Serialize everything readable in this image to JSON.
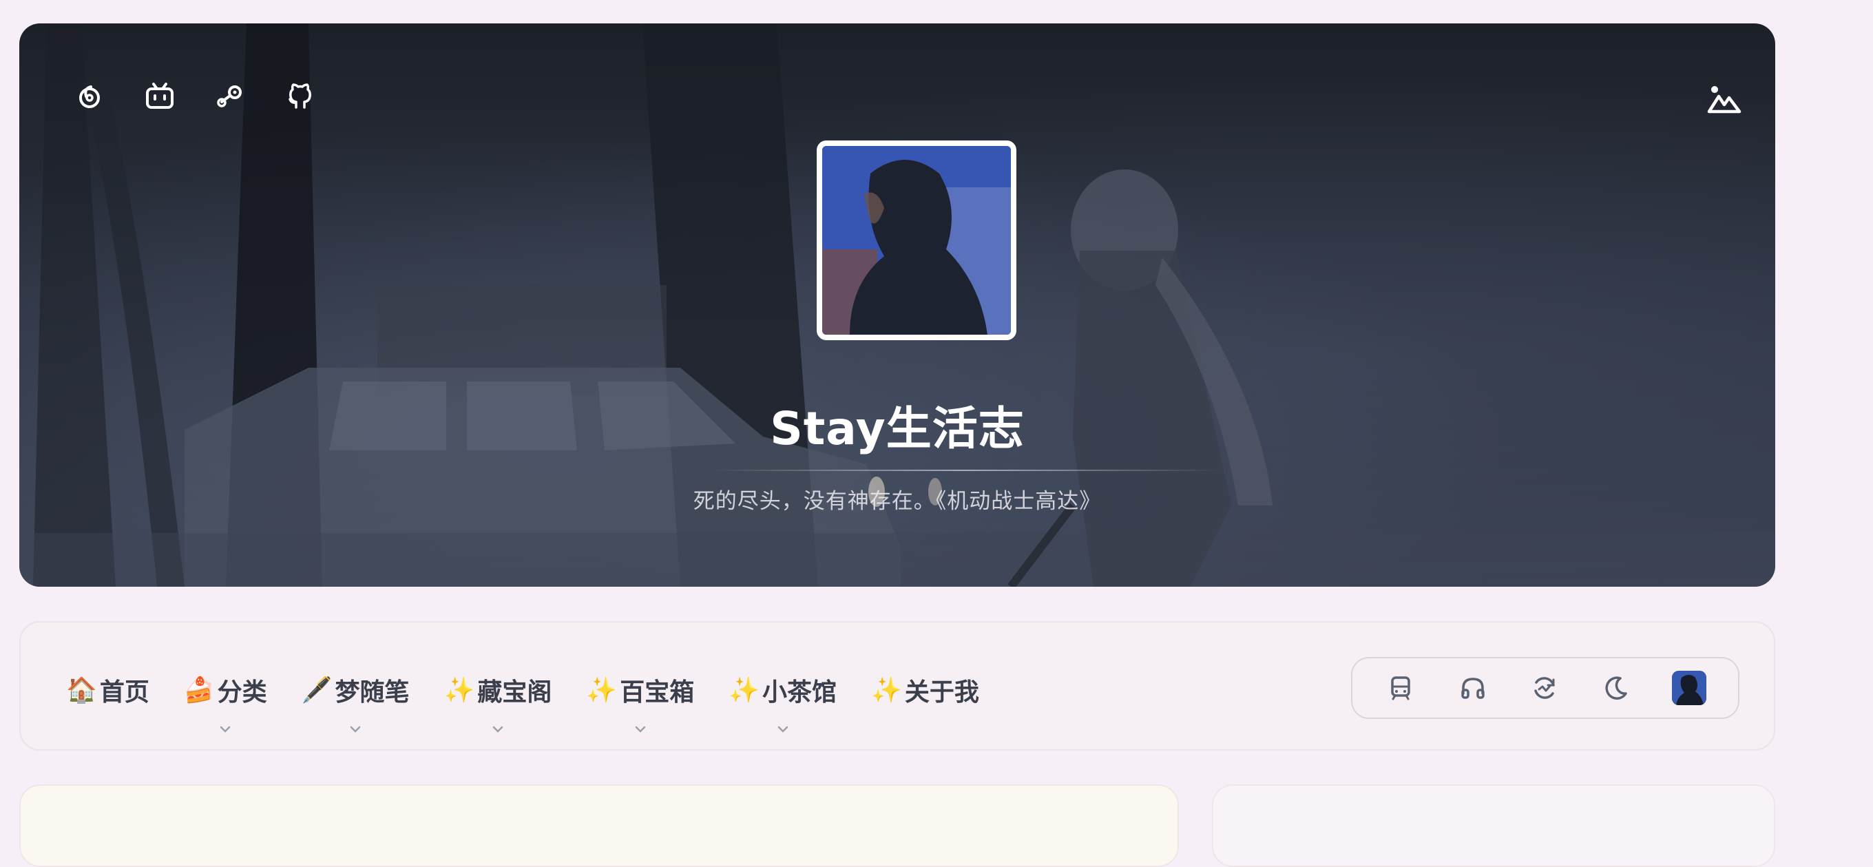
{
  "header": {
    "site_title": "Stay生活志",
    "motto": "死的尽头，没有神存在。《机动战士高达》",
    "social_icons": [
      "netease-music-icon",
      "bilibili-icon",
      "steam-icon",
      "github-icon"
    ],
    "wallpaper_icon": "mountain-image-icon"
  },
  "nav": {
    "items": [
      {
        "emoji": "🏠",
        "label": "首页",
        "has_dropdown": false
      },
      {
        "emoji": "🍰",
        "label": "分类",
        "has_dropdown": true
      },
      {
        "emoji": "🖋️",
        "label": "梦随笔",
        "has_dropdown": true
      },
      {
        "emoji": "✨",
        "label": "藏宝阁",
        "has_dropdown": true
      },
      {
        "emoji": "✨",
        "label": "百宝箱",
        "has_dropdown": true
      },
      {
        "emoji": "✨",
        "label": "小茶馆",
        "has_dropdown": true
      },
      {
        "emoji": "✨",
        "label": "关于我",
        "has_dropdown": false
      }
    ],
    "tools": [
      "train-icon",
      "headphones-icon",
      "sync-activity-icon",
      "moon-icon",
      "user-avatar"
    ]
  },
  "colors": {
    "page_bg": "#f6eff7",
    "nav_text": "#3a3f4b",
    "tool_icon": "#5a6170"
  }
}
